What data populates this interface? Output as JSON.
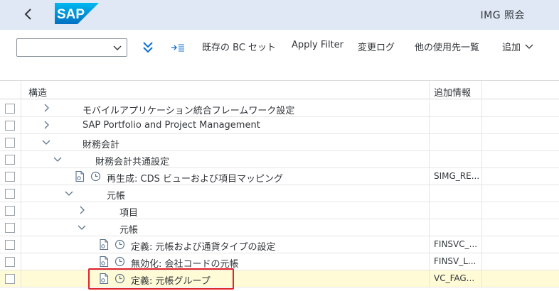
{
  "header": {
    "logo_text": "SAP",
    "title": "IMG 照会"
  },
  "toolbar": {
    "variant_value": "",
    "btn_existing_bc": "既存の BC セット",
    "btn_apply_filter": "Apply Filter",
    "btn_change_log": "変更ログ",
    "btn_where_used": "他の使用先一覧",
    "btn_add": "追加"
  },
  "table": {
    "col_structure": "構造",
    "col_info": "追加情報",
    "rows": [
      {
        "text": "モバイルアプリケーション統合フレームワーク設定",
        "info": "",
        "expander": "collapsed"
      },
      {
        "text": "SAP Portfolio and Project Management",
        "info": "",
        "expander": "collapsed"
      },
      {
        "text": "財務会計",
        "info": "",
        "expander": "expanded"
      },
      {
        "text": "財務会計共通設定",
        "info": "",
        "expander": "expanded"
      },
      {
        "text": "再生成: CDS ビューおよび項目マッピング",
        "info": "SIMG_RE...",
        "expander": "none"
      },
      {
        "text": "元帳",
        "info": "",
        "expander": "expanded"
      },
      {
        "text": "項目",
        "info": "",
        "expander": "collapsed"
      },
      {
        "text": "元帳",
        "info": "",
        "expander": "expanded"
      },
      {
        "text": "定義: 元帳および通貨タイプの設定",
        "info": "FINSVC_...",
        "expander": "none"
      },
      {
        "text": "無効化: 会社コードの元帳",
        "info": "FINSV_L...",
        "expander": "none"
      },
      {
        "text": "定義: 元帳グループ",
        "info": "VC_FAG...",
        "expander": "none"
      }
    ]
  },
  "colors": {
    "header_bg": "#dfe8f4",
    "accent": "#0a6ed1",
    "selected_row": "#fffbd6",
    "highlight": "#e0242a"
  },
  "icons": [
    "back-icon",
    "chevron-down-icon",
    "double-chevron-down-icon",
    "indent-icon",
    "chevron-right-icon",
    "document-icon",
    "clock-icon"
  ]
}
